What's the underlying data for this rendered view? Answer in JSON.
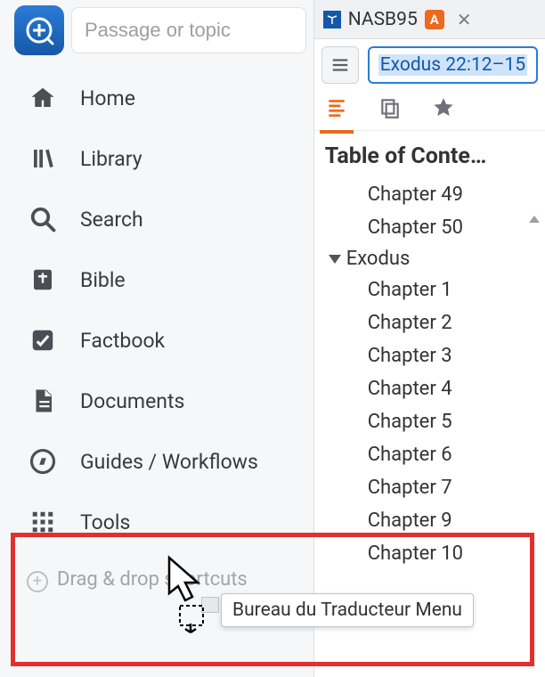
{
  "search": {
    "placeholder": "Passage or topic"
  },
  "sidebar": {
    "items": [
      {
        "label": "Home"
      },
      {
        "label": "Library"
      },
      {
        "label": "Search"
      },
      {
        "label": "Bible"
      },
      {
        "label": "Factbook"
      },
      {
        "label": "Documents"
      },
      {
        "label": "Guides / Workflows"
      },
      {
        "label": "Tools"
      }
    ],
    "drag_label": "Drag & drop shortcuts"
  },
  "tab": {
    "title": "NASB95",
    "badge": "A"
  },
  "reference": "Exodus 22:12–15",
  "toc_heading": "Table of Conte…",
  "toc": {
    "genesis_tail": [
      {
        "label": "Chapter 49"
      },
      {
        "label": "Chapter 50"
      }
    ],
    "book": "Exodus",
    "chapters": [
      {
        "label": "Chapter 1"
      },
      {
        "label": "Chapter 2"
      },
      {
        "label": "Chapter 3"
      },
      {
        "label": "Chapter 4"
      },
      {
        "label": "Chapter 5"
      },
      {
        "label": "Chapter 6"
      },
      {
        "label": "Chapter 7"
      },
      {
        "label": "Chapter 9"
      },
      {
        "label": "Chapter 10"
      }
    ]
  },
  "drag_tip": "Bureau du Traducteur Menu"
}
